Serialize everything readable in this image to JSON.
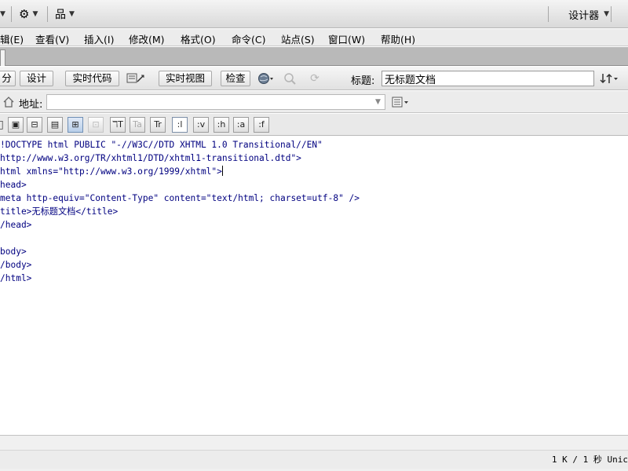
{
  "appbar": {
    "workspace_label": "设计器",
    "close_glyph": "✕"
  },
  "menu": {
    "items": [
      "编辑(E)",
      "查看(V)",
      "插入(I)",
      "修改(M)",
      "格式(O)",
      "命令(C)",
      "站点(S)",
      "窗口(W)",
      "帮助(H)"
    ],
    "visible_first": "辑(E)"
  },
  "tabs": [
    "x"
  ],
  "doc_toolbar": {
    "split_label": "分",
    "design_label": "设计",
    "live_code_label": "实时代码",
    "live_view_label": "实时视图",
    "inspect_label": "检查",
    "title_label": "标题:",
    "title_value": "无标题文档"
  },
  "address": {
    "label": "地址:",
    "value": ""
  },
  "code_toolbar": {
    "buttons": [
      ":l",
      ":v",
      ":h",
      ":a",
      ":f"
    ]
  },
  "code": {
    "lines": [
      "!DOCTYPE html PUBLIC \"-//W3C//DTD XHTML 1.0 Transitional//EN\"",
      "http://www.w3.org/TR/xhtml1/DTD/xhtml1-transitional.dtd\">",
      "html xmlns=\"http://www.w3.org/1999/xhtml\">",
      "head>",
      "meta http-equiv=\"Content-Type\" content=\"text/html; charset=utf-8\" />",
      "title>无标题文档</title>",
      "/head>",
      "",
      "body>",
      "/body>",
      "/html>"
    ]
  },
  "status": {
    "text": "1 K / 1 秒 Unic"
  }
}
